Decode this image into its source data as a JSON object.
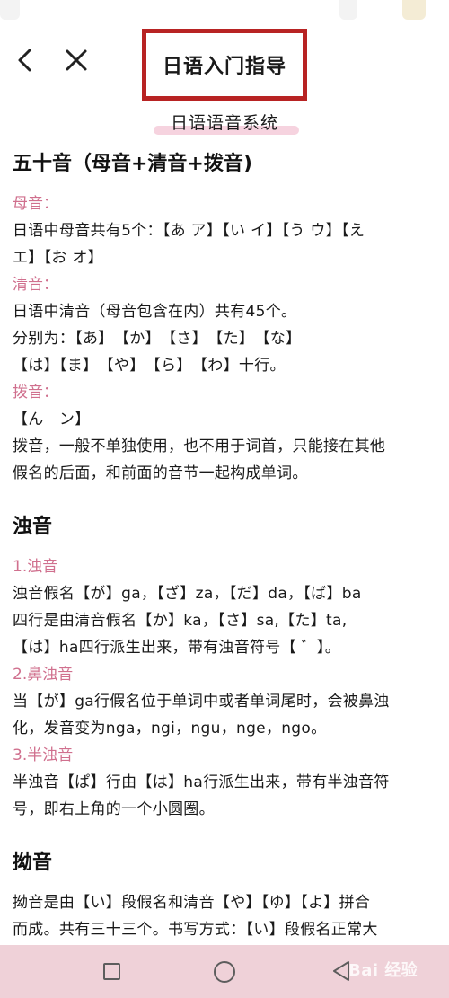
{
  "header": {
    "title": "日语入门指导",
    "back_icon": "chevron-left-icon",
    "close_icon": "close-icon"
  },
  "subtitle": "日语语音系统",
  "colors": {
    "accent": "#d0708e",
    "frame": "#b82323",
    "highlight": "#f6d3df",
    "navbar": "#efd1d8"
  },
  "sections": [
    {
      "heading": "五十音（母音+清音+拨音)",
      "lines": [
        {
          "type": "label",
          "text": "母音："
        },
        {
          "type": "text",
          "text": "日语中母音共有5个：【あ ア】【い イ】【う ウ】【え"
        },
        {
          "type": "text",
          "text": "エ】【お オ】"
        },
        {
          "type": "label",
          "text": "清音："
        },
        {
          "type": "text",
          "text": "日语中清音（母音包含在内）共有45个。"
        },
        {
          "type": "text",
          "text": "分别为：【あ】　【か】　【さ】　【た】　【な】"
        },
        {
          "type": "text",
          "text": "【は】【ま】　【や】　【ら】　【わ】十行。"
        },
        {
          "type": "label",
          "text": "拨音："
        },
        {
          "type": "text",
          "text": "【ん　ン】"
        },
        {
          "type": "text",
          "text": "拨音，一般不单独使用，也不用于词首，只能接在其他"
        },
        {
          "type": "text",
          "text": "假名的后面，和前面的音节一起构成单词。"
        }
      ]
    },
    {
      "heading": "浊音",
      "lines": [
        {
          "type": "label",
          "text": "1.浊音"
        },
        {
          "type": "text",
          "text": "浊音假名【が】ga，【ざ】za，【だ】da，【ば】ba"
        },
        {
          "type": "text",
          "text": "四行是由清音假名【か】ka，【さ】sa,【た】ta,"
        },
        {
          "type": "text",
          "text": "【は】ha四行派生出来，带有浊音符号【 ゛】。"
        },
        {
          "type": "label",
          "text": "2.鼻浊音"
        },
        {
          "type": "text",
          "text": "当【が】ga行假名位于单词中或者单词尾时，会被鼻浊"
        },
        {
          "type": "text",
          "text": "化，发音变为nga，ngi，ngu，nge，ngo。"
        },
        {
          "type": "label",
          "text": "3.半浊音"
        },
        {
          "type": "text",
          "text": "半浊音【ぱ】行由【は】ha行派生出来，带有半浊音符"
        },
        {
          "type": "text",
          "text": "号，即右上角的一个小圆圈。"
        }
      ]
    },
    {
      "heading": "拗音",
      "lines": [
        {
          "type": "text",
          "text": "拗音是由【い】段假名和清音【や】【ゆ】【よ】拼合"
        },
        {
          "type": "text",
          "text": "而成。共有三十三个。书写方式：【い】段假名正常大"
        }
      ]
    }
  ],
  "navbar": {
    "watermark": "Bai 经验"
  }
}
